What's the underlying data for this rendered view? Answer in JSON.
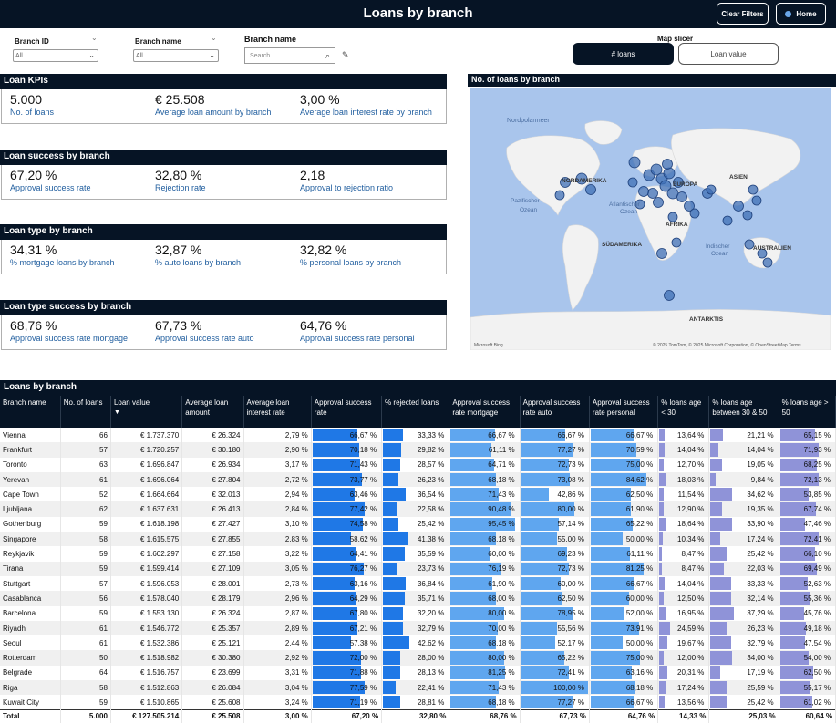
{
  "header": {
    "title": "Loans by branch",
    "clear_filters": "Clear Filters",
    "home": "Home"
  },
  "filters": {
    "branch_id_label": "Branch ID",
    "branch_id_value": "All",
    "branch_name_dd_label": "Branch name",
    "branch_name_dd_value": "All",
    "branch_name_search_label": "Branch name",
    "search_placeholder": "Search",
    "map_slicer_label": "Map slicer",
    "opt_loans": "# loans",
    "opt_value": "Loan value"
  },
  "kpis": {
    "section1": {
      "title": "Loan KPIs",
      "items": [
        {
          "value": "5.000",
          "label": "No. of loans"
        },
        {
          "value": "€ 25.508",
          "label": "Average loan amount by branch"
        },
        {
          "value": "3,00 %",
          "label": "Average loan interest rate by branch"
        }
      ]
    },
    "section2": {
      "title": "Loan success by branch",
      "items": [
        {
          "value": "67,20 %",
          "label": "Approval success rate"
        },
        {
          "value": "32,80 %",
          "label": "Rejection rate"
        },
        {
          "value": "2,18",
          "label": "Approval to rejection ratio"
        }
      ]
    },
    "section3": {
      "title": "Loan type by branch",
      "items": [
        {
          "value": "34,31 %",
          "label": "% mortgage loans by branch"
        },
        {
          "value": "32,87 %",
          "label": "% auto loans by branch"
        },
        {
          "value": "32,82 %",
          "label": "% personal loans by branch"
        }
      ]
    },
    "section4": {
      "title": "Loan type success by branch",
      "items": [
        {
          "value": "68,76 %",
          "label": "Approval success rate mortgage"
        },
        {
          "value": "67,73 %",
          "label": "Approval success rate auto"
        },
        {
          "value": "64,76 %",
          "label": "Approval success rate personal"
        }
      ]
    }
  },
  "map": {
    "title": "No. of loans by branch",
    "labels": {
      "nordpolarmeer": "Nordpolarmeer",
      "nordamerika": "NORDAMERIKA",
      "asien": "ASIEN",
      "europa": "EUROPA",
      "pazifik1": "Pazifischer",
      "pazifik2": "Ozean",
      "atlantik1": "Atlantischer",
      "atlantik2": "Ozean",
      "afrika": "AFRIKA",
      "suedamerika": "SÜDAMERIKA",
      "indisch1": "Indischer",
      "indisch2": "Ozean",
      "australien": "AUSTRALIEN",
      "antarktis": "ANTARKTIS"
    },
    "attribution": "© 2025 TomTom, © 2025 Microsoft Corporation, © OpenStreetMap  Terms",
    "brand": "Microsoft Bing",
    "colors": {
      "water": "#a9c5ec",
      "land": "#f2f2f2",
      "bubble": "#3f6fb5"
    }
  },
  "table": {
    "title": "Loans by branch",
    "columns": [
      "Branch name",
      "No. of loans",
      "Loan value",
      "Average loan amount",
      "Average loan interest rate",
      "Approval success rate",
      "% rejected loans",
      "Approval success rate mortgage",
      "Approval success rate auto",
      "Approval success rate personal",
      "% loans age < 30",
      "% loans age between 30 & 50",
      "% loans age > 50"
    ],
    "sort_indicator": "▼",
    "rows": [
      [
        "Vienna",
        "66",
        "€ 1.737.370",
        "€ 26.324",
        "2,79 %",
        "66,67 %",
        "33,33 %",
        "66,67 %",
        "66,67 %",
        "66,67 %",
        "13,64 %",
        "21,21 %",
        "65,15 %"
      ],
      [
        "Frankfurt",
        "57",
        "€ 1.720.257",
        "€ 30.180",
        "2,90 %",
        "70,18 %",
        "29,82 %",
        "61,11 %",
        "77,27 %",
        "70,59 %",
        "14,04 %",
        "14,04 %",
        "71,93 %"
      ],
      [
        "Toronto",
        "63",
        "€ 1.696.847",
        "€ 26.934",
        "3,17 %",
        "71,43 %",
        "28,57 %",
        "64,71 %",
        "72,73 %",
        "75,00 %",
        "12,70 %",
        "19,05 %",
        "68,25 %"
      ],
      [
        "Yerevan",
        "61",
        "€ 1.696.064",
        "€ 27.804",
        "2,72 %",
        "73,77 %",
        "26,23 %",
        "68,18 %",
        "73,08 %",
        "84,62 %",
        "18,03 %",
        "9,84 %",
        "72,13 %"
      ],
      [
        "Cape Town",
        "52",
        "€ 1.664.664",
        "€ 32.013",
        "2,94 %",
        "63,46 %",
        "36,54 %",
        "71,43 %",
        "42,86 %",
        "62,50 %",
        "11,54 %",
        "34,62 %",
        "53,85 %"
      ],
      [
        "Ljubljana",
        "62",
        "€ 1.637.631",
        "€ 26.413",
        "2,84 %",
        "77,42 %",
        "22,58 %",
        "90,48 %",
        "80,00 %",
        "61,90 %",
        "12,90 %",
        "19,35 %",
        "67,74 %"
      ],
      [
        "Gothenburg",
        "59",
        "€ 1.618.198",
        "€ 27.427",
        "3,10 %",
        "74,58 %",
        "25,42 %",
        "95,45 %",
        "57,14 %",
        "65,22 %",
        "18,64 %",
        "33,90 %",
        "47,46 %"
      ],
      [
        "Singapore",
        "58",
        "€ 1.615.575",
        "€ 27.855",
        "2,83 %",
        "58,62 %",
        "41,38 %",
        "68,18 %",
        "55,00 %",
        "50,00 %",
        "10,34 %",
        "17,24 %",
        "72,41 %"
      ],
      [
        "Reykjavik",
        "59",
        "€ 1.602.297",
        "€ 27.158",
        "3,22 %",
        "64,41 %",
        "35,59 %",
        "60,00 %",
        "69,23 %",
        "61,11 %",
        "8,47 %",
        "25,42 %",
        "66,10 %"
      ],
      [
        "Tirana",
        "59",
        "€ 1.599.414",
        "€ 27.109",
        "3,05 %",
        "76,27 %",
        "23,73 %",
        "76,19 %",
        "72,73 %",
        "81,25 %",
        "8,47 %",
        "22,03 %",
        "69,49 %"
      ],
      [
        "Stuttgart",
        "57",
        "€ 1.596.053",
        "€ 28.001",
        "2,73 %",
        "63,16 %",
        "36,84 %",
        "61,90 %",
        "60,00 %",
        "66,67 %",
        "14,04 %",
        "33,33 %",
        "52,63 %"
      ],
      [
        "Casablanca",
        "56",
        "€ 1.578.040",
        "€ 28.179",
        "2,96 %",
        "64,29 %",
        "35,71 %",
        "68,00 %",
        "62,50 %",
        "60,00 %",
        "12,50 %",
        "32,14 %",
        "55,36 %"
      ],
      [
        "Barcelona",
        "59",
        "€ 1.553.130",
        "€ 26.324",
        "2,87 %",
        "67,80 %",
        "32,20 %",
        "80,00 %",
        "78,95 %",
        "52,00 %",
        "16,95 %",
        "37,29 %",
        "45,76 %"
      ],
      [
        "Riyadh",
        "61",
        "€ 1.546.772",
        "€ 25.357",
        "2,89 %",
        "67,21 %",
        "32,79 %",
        "70,00 %",
        "55,56 %",
        "73,91 %",
        "24,59 %",
        "26,23 %",
        "49,18 %"
      ],
      [
        "Seoul",
        "61",
        "€ 1.532.386",
        "€ 25.121",
        "2,44 %",
        "57,38 %",
        "42,62 %",
        "68,18 %",
        "52,17 %",
        "50,00 %",
        "19,67 %",
        "32,79 %",
        "47,54 %"
      ],
      [
        "Rotterdam",
        "50",
        "€ 1.518.982",
        "€ 30.380",
        "2,92 %",
        "72,00 %",
        "28,00 %",
        "80,00 %",
        "65,22 %",
        "75,00 %",
        "12,00 %",
        "34,00 %",
        "54,00 %"
      ],
      [
        "Belgrade",
        "64",
        "€ 1.516.757",
        "€ 23.699",
        "3,31 %",
        "71,88 %",
        "28,13 %",
        "81,25 %",
        "72,41 %",
        "63,16 %",
        "20,31 %",
        "17,19 %",
        "62,50 %"
      ],
      [
        "Riga",
        "58",
        "€ 1.512.863",
        "€ 26.084",
        "3,04 %",
        "77,59 %",
        "22,41 %",
        "71,43 %",
        "100,00 %",
        "68,18 %",
        "17,24 %",
        "25,59 %",
        "55,17 %"
      ],
      [
        "Kuwait City",
        "59",
        "€ 1.510.865",
        "€ 25.608",
        "3,24 %",
        "71,19 %",
        "28,81 %",
        "68,18 %",
        "77,27 %",
        "66,67 %",
        "13,56 %",
        "25,42 %",
        "61,02 %"
      ]
    ],
    "total": [
      "Total",
      "5.000",
      "€ 127.505.214",
      "€ 25.508",
      "3,00 %",
      "67,20 %",
      "32,80 %",
      "68,76 %",
      "67,73 %",
      "64,76 %",
      "14,33 %",
      "25,03 %",
      "60,64 %"
    ],
    "bar_colors": {
      "approval": "#1f78e6",
      "rejected": "#1f78e6",
      "type": "#5fa6ef",
      "age": "#8f93d8"
    }
  }
}
